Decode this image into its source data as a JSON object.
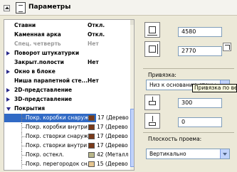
{
  "header": {
    "title": "Параметры"
  },
  "list": {
    "rows": [
      {
        "name": "Ставни",
        "value": "Откл."
      },
      {
        "name": "Каменная арка",
        "value": "Откл."
      },
      {
        "name": "Спец. четверть",
        "value": "Нет"
      },
      {
        "name": "Поворот штукатурки"
      },
      {
        "name": "Закрыт.полости",
        "value": "Нет"
      },
      {
        "name": "Окно в блоке"
      },
      {
        "name": "Ниша парапетной сте...",
        "value": "Нет"
      },
      {
        "name": "2D-представление"
      },
      {
        "name": "3D-представление"
      },
      {
        "name": "Покрытия"
      }
    ],
    "sub_rows": [
      {
        "name": "Покр. коробки снаружи",
        "material": "17 (Дерево",
        "color": "#7a3a1a"
      },
      {
        "name": "Покр. коробки внутри",
        "material": "17 (Дерево",
        "color": "#7a3a1a"
      },
      {
        "name": "Покр. створки снаружи",
        "material": "17 (Дерево",
        "color": "#7a3a1a"
      },
      {
        "name": "Покр. створки внутри",
        "material": "17 (Дерево",
        "color": "#7a3a1a"
      },
      {
        "name": "Покр. остекл.",
        "material": "42 (Металл",
        "color": "#b9b78a"
      },
      {
        "name": "Покр. перегородок сн...",
        "material": "15 (Дерево",
        "color": "#e6c690"
      }
    ]
  },
  "right": {
    "width_value": "4580",
    "height_value": "2770",
    "anchor_label": "Привязка:",
    "anchor_value": "Низ к основанию стены",
    "tooltip": "Привязка по вертикали",
    "offset_value": "300",
    "offset2_value": "0",
    "plane_label": "Плоскость проема:",
    "plane_value": "Вертикально"
  }
}
